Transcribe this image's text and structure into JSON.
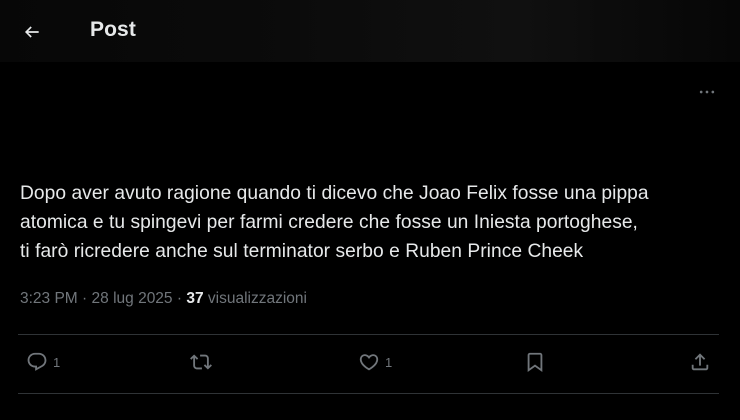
{
  "header": {
    "title": "Post"
  },
  "post": {
    "text": "Dopo aver avuto ragione quando ti dicevo che Joao Felix fosse una pippa\natomica e tu spingevi per farmi credere che fosse un Iniesta portoghese,\nti farò ricredere anche sul terminator serbo e Ruben Prince Cheek",
    "time": "3:23 PM",
    "separator": "·",
    "date": "28 lug 2025",
    "views_count": "37",
    "views_label": "visualizzazioni"
  },
  "actions": {
    "reply_count": "1",
    "retweet_count": "",
    "like_count": "1"
  },
  "icons": {
    "back": "arrow-left-icon",
    "more": "more-horizontal-icon",
    "reply": "comment-bubble-icon",
    "retweet": "retweet-icon",
    "like": "heart-icon",
    "bookmark": "bookmark-icon",
    "share": "share-upload-icon"
  },
  "colors": {
    "background": "#000000",
    "text_primary": "#e7e9ea",
    "text_secondary": "#71767b",
    "divider": "#2f3336"
  }
}
